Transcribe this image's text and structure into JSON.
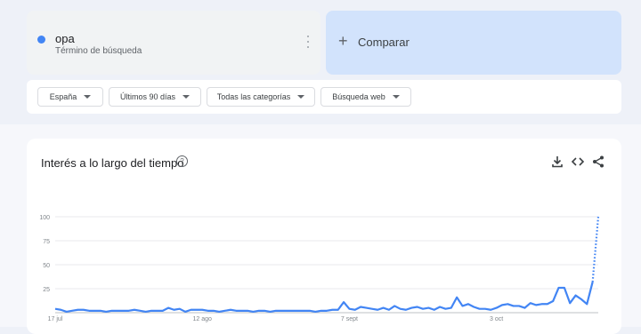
{
  "search_term": {
    "name": "opa",
    "subtitle": "Término de búsqueda",
    "color": "#4285f4"
  },
  "compare": {
    "plus": "+",
    "label": "Comparar"
  },
  "filters": {
    "region": "España",
    "period": "Últimos 90 días",
    "category": "Todas las categorías",
    "search_type": "Búsqueda web"
  },
  "chart_card": {
    "title": "Interés a lo largo del tiempo",
    "help_glyph": "?"
  },
  "icons": [
    "download-icon",
    "embed-icon",
    "share-icon",
    "help-icon",
    "more-vert-icon",
    "plus-icon",
    "chevron-down-icon"
  ],
  "chart_data": {
    "type": "line",
    "title": "",
    "xlabel": "",
    "ylabel": "",
    "ylim": [
      0,
      100
    ],
    "yticks": [
      25,
      50,
      75,
      100
    ],
    "xtick_labels": [
      "17 jul",
      "12 ago",
      "7 sept",
      "3 oct"
    ],
    "xtick_indices": [
      0,
      26,
      52,
      78
    ],
    "series": [
      {
        "color": "#4285f4",
        "values": [
          4,
          3,
          1,
          2,
          3,
          3,
          2,
          2,
          2,
          1,
          2,
          2,
          2,
          2,
          3,
          2,
          1,
          2,
          2,
          2,
          5,
          3,
          4,
          1,
          3,
          3,
          3,
          2,
          2,
          1,
          2,
          3,
          2,
          2,
          2,
          1,
          2,
          2,
          1,
          2,
          2,
          2,
          2,
          2,
          2,
          2,
          1,
          2,
          2,
          3,
          3,
          11,
          4,
          3,
          6,
          5,
          4,
          3,
          5,
          3,
          7,
          4,
          3,
          5,
          6,
          4,
          5,
          3,
          6,
          4,
          5,
          16,
          7,
          9,
          6,
          4,
          4,
          3,
          5,
          8,
          9,
          7,
          7,
          5,
          10,
          8,
          9,
          9,
          12,
          26,
          26,
          10,
          18,
          14,
          9,
          32
        ],
        "partial_point": 100
      }
    ]
  }
}
